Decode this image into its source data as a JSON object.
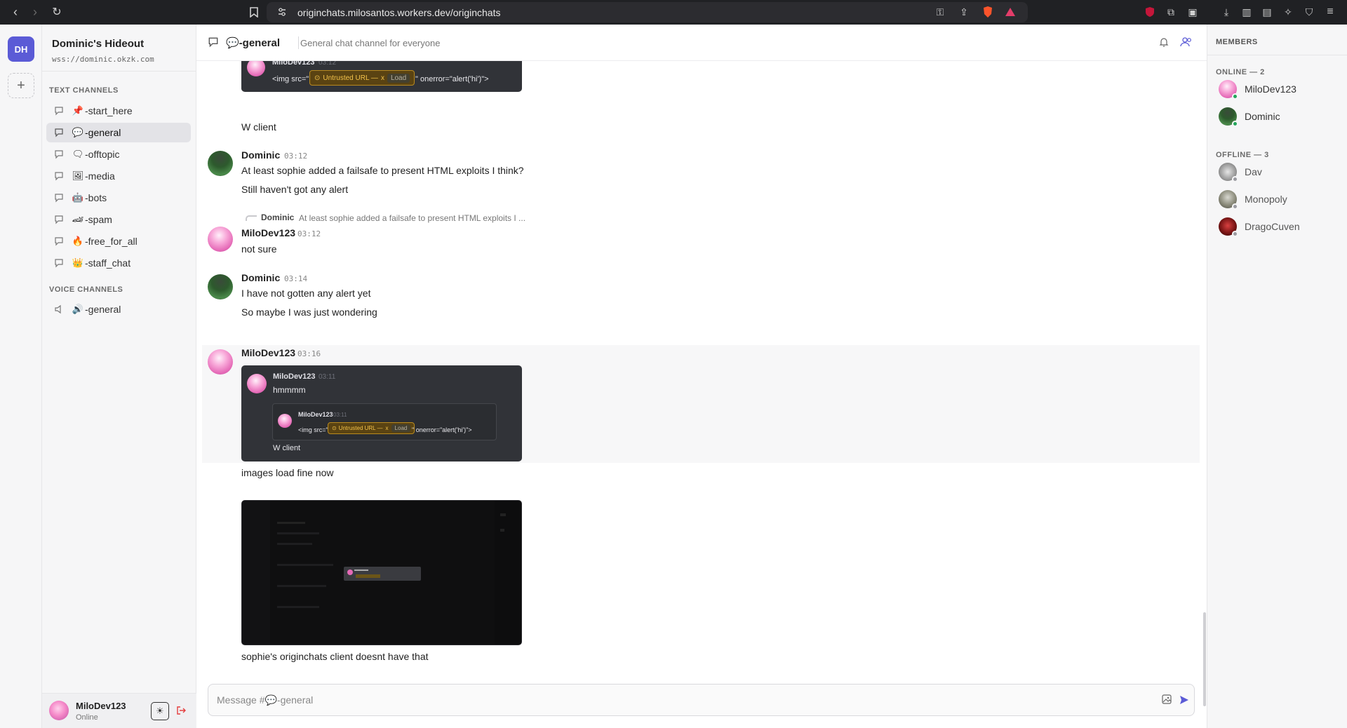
{
  "browser": {
    "url": "originchats.milosantos.workers.dev/originchats",
    "shield_badge": "1"
  },
  "server": {
    "badge": "DH",
    "name": "Dominic's Hideout",
    "url": "wss://dominic.okzk.com"
  },
  "sidebar": {
    "text_section": "TEXT CHANNELS",
    "voice_section": "VOICE CHANNELS",
    "text_channels": [
      {
        "emoji": "📌",
        "label": "-start_here"
      },
      {
        "emoji": "💬",
        "label": "-general"
      },
      {
        "emoji": "🗨",
        "label": "-offtopic"
      },
      {
        "emoji": "🖼",
        "label": "-media"
      },
      {
        "emoji": "🤖",
        "label": "-bots"
      },
      {
        "emoji": "🏎",
        "label": "-spam"
      },
      {
        "emoji": "🔥",
        "label": "-free_for_all"
      },
      {
        "emoji": "👑",
        "label": "-staff_chat"
      }
    ],
    "voice_channels": [
      {
        "emoji": "🔊",
        "label": "-general"
      }
    ]
  },
  "user_panel": {
    "name": "MiloDev123",
    "status": "Online"
  },
  "header": {
    "channel": "💬-general",
    "description": "General chat channel for everyone"
  },
  "messages": {
    "m0_text": "W client",
    "top_embed": {
      "author": "MiloDev123",
      "time": "03:12",
      "prefix": "<img src=\"",
      "suffix": "\" onerror=\"alert('hi')\">"
    },
    "m1": {
      "author": "Dominic",
      "time": "03:12",
      "line1": "At least sophie added a failsafe to present HTML exploits I think?",
      "line2": "Still haven't got any alert"
    },
    "m2": {
      "reply_author": "Dominic",
      "reply_text": "At least sophie added a failsafe to present HTML exploits I ...",
      "author": "MiloDev123",
      "time": "03:12",
      "text": "not sure"
    },
    "m3": {
      "author": "Dominic",
      "time": "03:14",
      "line1": "I have not gotten any alert yet",
      "line2": "So maybe I was just wondering"
    },
    "m4": {
      "author": "MiloDev123",
      "time": "03:16",
      "embed_author": "MiloDev123",
      "embed_time": "03:11",
      "embed_text": "hmmmm",
      "nested_author": "MiloDev123",
      "nested_time": "03:11",
      "nested_prefix": "<img src=\"",
      "nested_suffix": "\" onerror=\"alert('hi')\">",
      "embed_footer": "W client",
      "after1": "images load fine now",
      "after2": "sophie's originchats client doesnt have that"
    }
  },
  "untrusted": {
    "label": "Untrusted URL —",
    "close": "x",
    "load": "Load"
  },
  "composer": {
    "placeholder": "Message #💬-general"
  },
  "members": {
    "title": "MEMBERS",
    "online_label": "ONLINE — 2",
    "offline_label": "OFFLINE — 3",
    "online": [
      {
        "name": "MiloDev123",
        "avatar_color": "#e56ab7"
      },
      {
        "name": "Dominic",
        "avatar_color": "#2d5a2d"
      }
    ],
    "offline": [
      {
        "name": "Dav",
        "avatar_color": "#8a8a8a"
      },
      {
        "name": "Monopoly",
        "avatar_color": "#6a6a5a"
      },
      {
        "name": "DragoCuven",
        "avatar_color": "#7a1515"
      }
    ],
    "status_colors": {
      "online": "#23a55a",
      "offline": "#9a9aa0"
    }
  },
  "colors": {
    "accent": "#5b5bd6",
    "embed_bg": "#313338",
    "warning": "#f3c24a"
  }
}
